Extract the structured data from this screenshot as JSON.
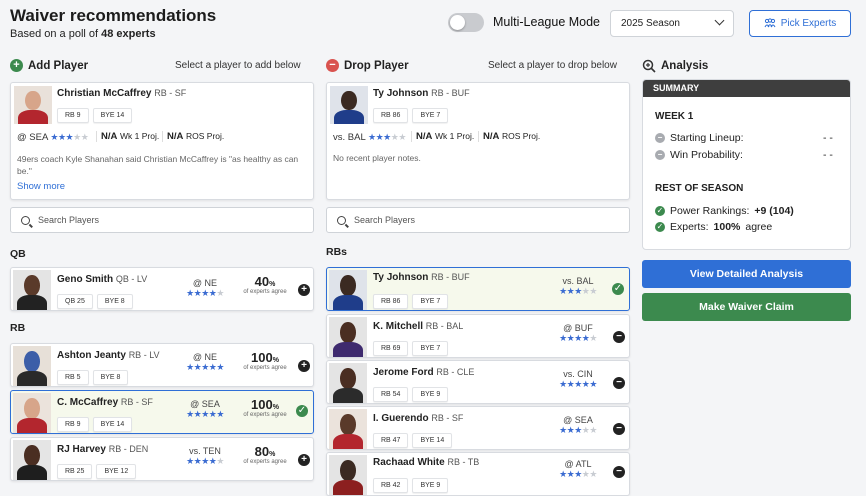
{
  "header": {
    "title": "Waiver recommendations",
    "subtitle_prefix": "Based on a poll of",
    "subtitle_count": "48 experts",
    "toggle_label": "Multi-League Mode",
    "season": "2025 Season",
    "pick_experts": "Pick Experts"
  },
  "add_panel": {
    "title": "Add Player",
    "hint": "Select a player to add below",
    "selected": {
      "name": "Christian McCaffrey",
      "pos": "RB - SF",
      "rank": "RB 9",
      "bye": "BYE 14",
      "opp": "@ SEA",
      "wk_proj": "N/A",
      "wk_proj_label": "Wk 1 Proj.",
      "ros_proj": "N/A",
      "ros_proj_label": "ROS Proj.",
      "note": "49ers coach Kyle Shanahan said Christian McCaffrey is \"as healthy as can be.\"",
      "show_more": "Show more"
    },
    "search_placeholder": "Search Players",
    "groups": [
      {
        "label": "QB"
      },
      {
        "label": "RB"
      }
    ],
    "players": [
      {
        "name": "Geno Smith",
        "pos": "QB - LV",
        "rank": "QB 25",
        "bye": "BYE 8",
        "opp": "@ NE",
        "pct": "40",
        "pct_sign": "%",
        "pct_label": "of experts agree"
      },
      {
        "name": "Ashton Jeanty",
        "pos": "RB - LV",
        "rank": "RB 5",
        "bye": "BYE 8",
        "opp": "@ NE",
        "pct": "100",
        "pct_sign": "%",
        "pct_label": "of experts agree"
      },
      {
        "name": "C. McCaffrey",
        "pos": "RB - SF",
        "rank": "RB 9",
        "bye": "BYE 14",
        "opp": "@ SEA",
        "pct": "100",
        "pct_sign": "%",
        "pct_label": "of experts agree"
      },
      {
        "name": "RJ Harvey",
        "pos": "RB - DEN",
        "rank": "RB 25",
        "bye": "BYE 12",
        "opp": "vs. TEN",
        "pct": "80",
        "pct_sign": "%",
        "pct_label": "of experts agree"
      }
    ]
  },
  "drop_panel": {
    "title": "Drop Player",
    "hint": "Select a player to drop below",
    "selected": {
      "name": "Ty Johnson",
      "pos": "RB - BUF",
      "rank": "RB 86",
      "bye": "BYE 7",
      "opp": "vs. BAL",
      "wk_proj": "N/A",
      "wk_proj_label": "Wk 1 Proj.",
      "ros_proj": "N/A",
      "ros_proj_label": "ROS Proj.",
      "note": "No recent player notes."
    },
    "search_placeholder": "Search Players",
    "group_label": "RBs",
    "players": [
      {
        "name": "Ty Johnson",
        "pos": "RB - BUF",
        "rank": "RB 86",
        "bye": "BYE 7",
        "opp": "vs. BAL"
      },
      {
        "name": "K. Mitchell",
        "pos": "RB - BAL",
        "rank": "RB 69",
        "bye": "BYE 7",
        "opp": "@ BUF"
      },
      {
        "name": "Jerome Ford",
        "pos": "RB - CLE",
        "rank": "RB 54",
        "bye": "BYE 9",
        "opp": "vs. CIN"
      },
      {
        "name": "I. Guerendo",
        "pos": "RB - SF",
        "rank": "RB 47",
        "bye": "BYE 14",
        "opp": "@ SEA"
      },
      {
        "name": "Rachaad White",
        "pos": "RB - TB",
        "rank": "RB 42",
        "bye": "BYE 9",
        "opp": "@ ATL"
      }
    ]
  },
  "analysis": {
    "title": "Analysis",
    "summary_label": "SUMMARY",
    "week_label": "WEEK 1",
    "starting_lineup_label": "Starting Lineup:",
    "starting_lineup_value": "- -",
    "win_prob_label": "Win Probability:",
    "win_prob_value": "- -",
    "ros_label": "REST OF SEASON",
    "power_rank_label": "Power Rankings:",
    "power_rank_value": "+9 (104)",
    "experts_label": "Experts:",
    "experts_value": "100%",
    "experts_suffix": "agree",
    "view_detailed": "View Detailed Analysis",
    "make_claim": "Make Waiver Claim"
  },
  "colors": {
    "accent_blue": "#2f6fd6",
    "claim_green": "#3c8a4e",
    "star_blue": "#3a6bd1"
  }
}
